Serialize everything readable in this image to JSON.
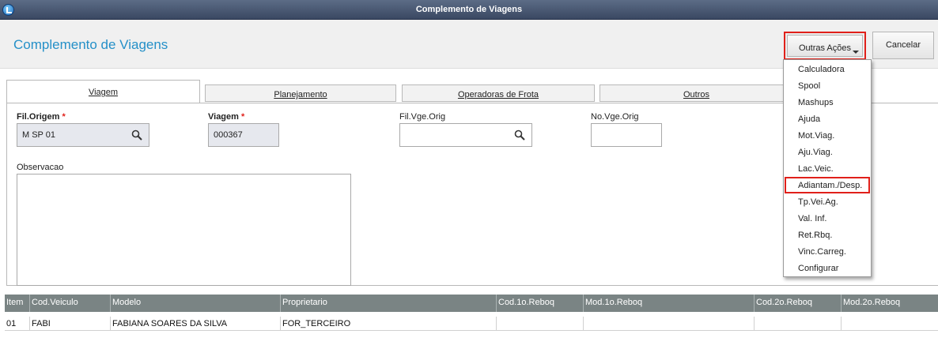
{
  "window": {
    "title": "Complemento de Viagens"
  },
  "header": {
    "page_title": "Complemento de Viagens",
    "outras_acoes_label": "Outras Ações",
    "cancelar_label": "Cancelar"
  },
  "tabs": [
    {
      "label": "Viagem",
      "active": true
    },
    {
      "label": "Planejamento",
      "active": false
    },
    {
      "label": "Operadoras de Frota",
      "active": false
    },
    {
      "label": "Outros",
      "active": false
    }
  ],
  "form": {
    "fil_origem": {
      "label": "Fil.Origem",
      "required_mark": "*",
      "value": "M SP 01"
    },
    "viagem": {
      "label": "Viagem",
      "required_mark": "*",
      "value": "000367"
    },
    "fil_vge_orig": {
      "label": "Fil.Vge.Orig",
      "value": ""
    },
    "no_vge_orig": {
      "label": "No.Vge.Orig",
      "value": ""
    },
    "observacao": {
      "label": "Observacao",
      "value": ""
    }
  },
  "menu": {
    "items": [
      "Calculadora",
      "Spool",
      "Mashups",
      "Ajuda",
      "Mot.Viag.",
      "Aju.Viag.",
      "Lac.Veic.",
      "Adiantam./Desp.",
      "Tp.Vei.Ag.",
      "Val. Inf.",
      "Ret.Rbq.",
      "Vinc.Carreg.",
      "Configurar"
    ],
    "highlighted_item": "Adiantam./Desp."
  },
  "grid": {
    "columns": [
      "Item",
      "Cod.Veiculo",
      "Modelo",
      "Proprietario",
      "Cod.1o.Reboq",
      "Mod.1o.Reboq",
      "Cod.2o.Reboq",
      "Mod.2o.Reboq"
    ],
    "rows": [
      [
        "01",
        "FABI",
        "FABIANA SOARES DA SILVA",
        "FOR_TERCEIRO",
        "",
        "",
        "",
        ""
      ]
    ]
  },
  "colors": {
    "title_accent": "#2590c8",
    "highlight_red": "#e0201a",
    "grid_header_bg": "#7a8484"
  }
}
